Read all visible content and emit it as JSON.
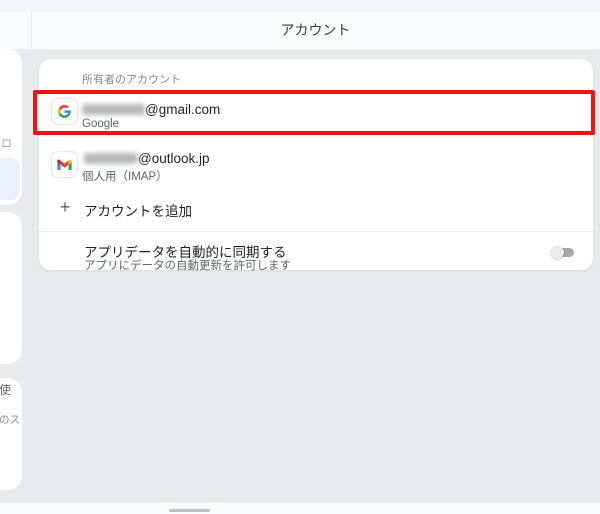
{
  "header": {
    "title": "アカウント"
  },
  "left_pane": {
    "selected_item": {
      "highlight_color": "#e8f1fd"
    },
    "fragments": [
      {
        "text": "ロ"
      },
      {
        "text": "使"
      },
      {
        "text": "のス"
      }
    ]
  },
  "accounts_card": {
    "section_label": "所有者のアカウント",
    "accounts": [
      {
        "icon": "google-g-icon",
        "email_domain": "@gmail.com",
        "provider": "Google",
        "username_blurred": true,
        "highlighted": true
      },
      {
        "icon": "gmail-m-icon",
        "email_domain": "@outlook.jp",
        "provider": "個人用（IMAP）",
        "username_blurred": true,
        "highlighted": false
      }
    ],
    "add_account": {
      "icon_glyph": "+",
      "label": "アカウントを追加"
    },
    "sync": {
      "title": "アプリデータを自動的に同期する",
      "subtitle": "アプリにデータの自動更新を許可します",
      "toggle_state": "off"
    }
  },
  "annotation": {
    "highlight_border_color": "#ee1212"
  },
  "gesture_bar": {
    "present": true
  }
}
